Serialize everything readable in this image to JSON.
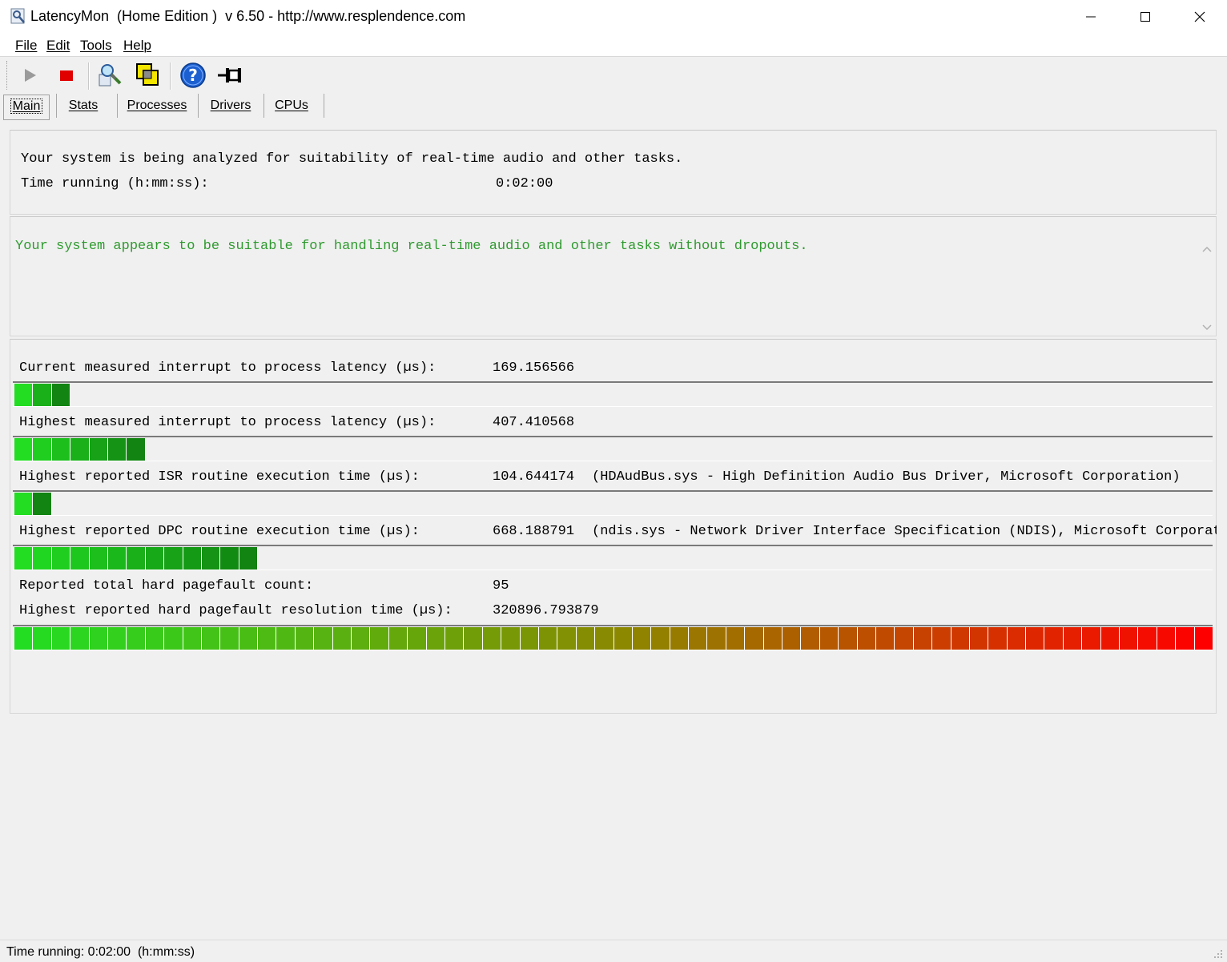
{
  "window": {
    "title": "LatencyMon  (Home Edition )  v 6.50 - http://www.resplendence.com"
  },
  "menu": {
    "items": [
      {
        "label": "File"
      },
      {
        "label": "Edit"
      },
      {
        "label": "Tools"
      },
      {
        "label": "Help"
      }
    ]
  },
  "toolbar": {
    "buttons": [
      "play-icon",
      "stop-icon",
      "magnifier-analyze-icon",
      "window-overlay-icon",
      "help-icon",
      "pin-icon"
    ]
  },
  "tabs": [
    {
      "label": "Main",
      "active": true
    },
    {
      "label": "Stats",
      "active": false
    },
    {
      "label": "Processes",
      "active": false
    },
    {
      "label": "Drivers",
      "active": false
    },
    {
      "label": "CPUs",
      "active": false
    }
  ],
  "status_panel": {
    "line1": "Your system is being analyzed for suitability of real-time audio and other tasks.",
    "time_label": "Time running (h:mm:ss):",
    "time_value": "0:02:00"
  },
  "conclusion": {
    "text": "Your system appears to be suitable for handling real-time audio and other tasks without dropouts.",
    "color": "#2f9a2f"
  },
  "metrics": [
    {
      "label": "Current measured interrupt to process latency (µs):",
      "value": "169.156566",
      "detail": "",
      "level": 0.047
    },
    {
      "label": "Highest measured interrupt to process latency (µs):",
      "value": "407.410568",
      "detail": "",
      "level": 0.113
    },
    {
      "label": "Highest reported ISR routine execution time (µs):",
      "value": "104.644174",
      "detail": "(HDAudBus.sys - High Definition Audio Bus Driver, Microsoft Corporation)",
      "level": 0.031
    },
    {
      "label": "Highest reported DPC routine execution time (µs):",
      "value": "668.188791",
      "detail": "(ndis.sys - Network Driver Interface Specification (NDIS), Microsoft Corporat",
      "level": 0.196
    },
    {
      "label": "Reported total hard pagefault count:",
      "value": "95",
      "detail": ""
    },
    {
      "label": "Highest reported hard pagefault resolution time (µs):",
      "value": "320896.793879",
      "detail": "",
      "level": 1.0
    }
  ],
  "statusbar": {
    "text": "Time running: 0:02:00  (h:mm:ss)"
  },
  "colors": {
    "bar_green_start": "#22dd22",
    "bar_green_end": "#0f7a0f",
    "bar_gradient_mid": "#8a8a00",
    "bar_red_end": "#ff0000"
  }
}
